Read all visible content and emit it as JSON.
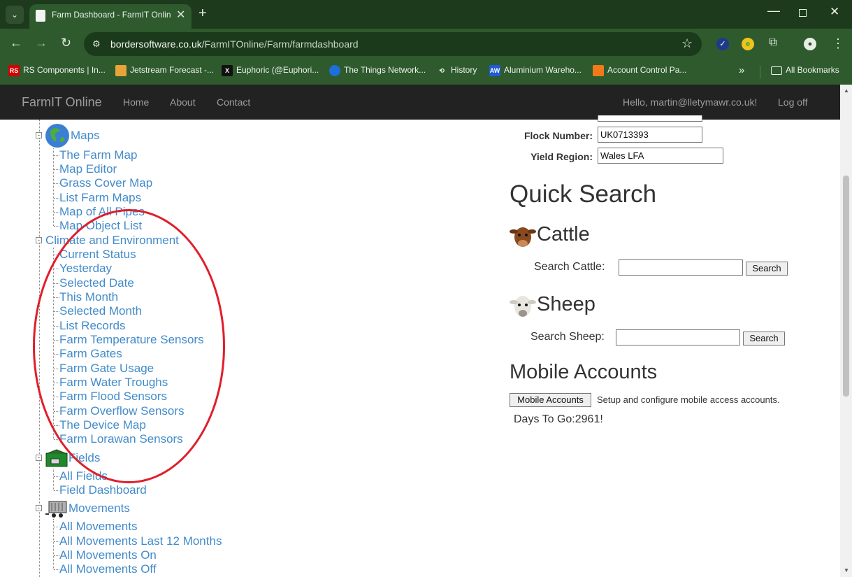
{
  "browser": {
    "tab_title": "Farm Dashboard - FarmIT Online",
    "url_host": "bordersoftware.co.uk",
    "url_path": "/FarmITOnline/Farm/farmdashboard",
    "bookmarks": [
      {
        "label": "RS Components | In...",
        "icon": "RS",
        "color": "#d40000"
      },
      {
        "label": "Jetstream Forecast -...",
        "icon": "",
        "color": "#e8a33a"
      },
      {
        "label": "Euphoric (@Euphori...",
        "icon": "X",
        "color": "#111111"
      },
      {
        "label": "The Things Network...",
        "icon": "",
        "color": "#1e6fd9"
      },
      {
        "label": "History",
        "icon": "⟲",
        "color": "#2e5a2e"
      },
      {
        "label": "Aluminium Wareho...",
        "icon": "AW",
        "color": "#1e5bd9"
      },
      {
        "label": "Account Control Pa...",
        "icon": "",
        "color": "#f07a1a"
      }
    ],
    "all_bookmarks": "All Bookmarks"
  },
  "site": {
    "brand": "FarmIT Online",
    "nav": [
      "Home",
      "About",
      "Contact"
    ],
    "greeting": "Hello, martin@lletymawr.co.uk!",
    "logoff": "Log off"
  },
  "tree": {
    "maps": {
      "label": "Maps",
      "items": [
        "The Farm Map",
        "Map Editor",
        "Grass Cover Map",
        "List Farm Maps",
        "Map of All Pipes",
        "Map Object List"
      ]
    },
    "climate": {
      "label": "Climate and Environment",
      "items": [
        "Current Status",
        "Yesterday",
        "Selected Date",
        "This Month",
        "Selected Month",
        "List Records",
        "Farm Temperature Sensors",
        "Farm Gates",
        "Farm Gate Usage",
        "Farm Water Troughs",
        "Farm Flood Sensors",
        "Farm Overflow Sensors",
        "The Device Map",
        "Farm Lorawan Sensors"
      ]
    },
    "fields": {
      "label": "Fields",
      "items": [
        "All Fields",
        "Field Dashboard"
      ]
    },
    "movements": {
      "label": "Movements",
      "items": [
        "All Movements",
        "All Movements Last 12 Months",
        "All Movements On",
        "All Movements Off"
      ]
    }
  },
  "farm_info": {
    "flock_label": "Flock Number:",
    "flock_value": "UK0713393",
    "yield_label": "Yield Region:",
    "yield_value": "Wales LFA"
  },
  "quick_search": {
    "title": "Quick Search",
    "cattle_title": "Cattle",
    "cattle_label": "Search Cattle:",
    "sheep_title": "Sheep",
    "sheep_label": "Search Sheep:",
    "search_button": "Search"
  },
  "mobile": {
    "title": "Mobile Accounts",
    "button": "Mobile Accounts",
    "description": "Setup and configure mobile access accounts.",
    "days_to_go": "Days To Go:2961!"
  }
}
